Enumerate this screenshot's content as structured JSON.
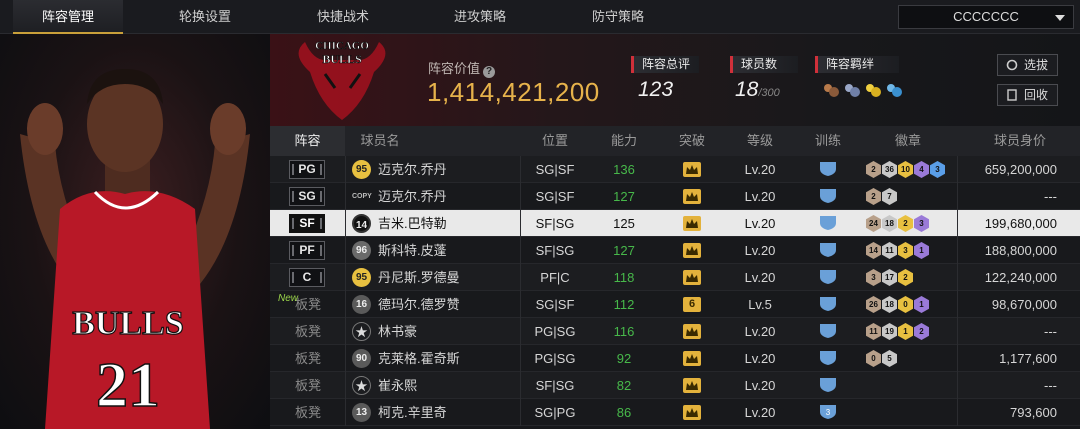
{
  "nav": {
    "tabs": [
      "阵容管理",
      "轮换设置",
      "快捷战术",
      "进攻策略",
      "防守策略"
    ],
    "active_index": 0,
    "team_select": "CCCCCCC"
  },
  "summary": {
    "value_label": "阵容价值",
    "value": "1,414,421,200",
    "overall_label": "阵容总评",
    "overall": "123",
    "count_label": "球员数",
    "count": "18",
    "count_max": "/300",
    "chem_label": "阵容羁绊",
    "select_button": "选拔",
    "recycle_button": "回收",
    "logo_text": "CHICAGO BULLS"
  },
  "table": {
    "headers": [
      "阵容",
      "球员名",
      "位置",
      "能力",
      "突破",
      "等级",
      "训练",
      "徽章",
      "球员身价"
    ],
    "rows": [
      {
        "slot": "PG",
        "rating": "95",
        "name": "迈克尔.乔丹",
        "pos": "SG|SF",
        "ability": "136",
        "break": "",
        "level": "Lv.20",
        "train": "",
        "badges": [
          "2",
          "36",
          "10",
          "4",
          "3"
        ],
        "salary": "659,200,000"
      },
      {
        "slot": "SG",
        "rating": "COPY",
        "name": "迈克尔.乔丹",
        "pos": "SG|SF",
        "ability": "127",
        "break": "",
        "level": "Lv.20",
        "train": "",
        "badges": [
          "2",
          "7"
        ],
        "salary": "---"
      },
      {
        "slot": "SF",
        "rating": "14",
        "name": "吉米.巴特勒",
        "pos": "SF|SG",
        "ability": "125",
        "break": "",
        "level": "Lv.20",
        "train": "",
        "badges": [
          "24",
          "18",
          "2",
          "3"
        ],
        "salary": "199,680,000"
      },
      {
        "slot": "PF",
        "rating": "96",
        "name": "斯科特.皮蓬",
        "pos": "SF|SG",
        "ability": "127",
        "break": "",
        "level": "Lv.20",
        "train": "",
        "badges": [
          "14",
          "11",
          "3",
          "1"
        ],
        "salary": "188,800,000"
      },
      {
        "slot": "C",
        "rating": "95",
        "name": "丹尼斯.罗德曼",
        "pos": "PF|C",
        "ability": "118",
        "break": "",
        "level": "Lv.20",
        "train": "",
        "badges": [
          "3",
          "17",
          "2"
        ],
        "salary": "122,240,000"
      },
      {
        "slot": "板凳",
        "new": "New",
        "rating": "16",
        "name": "德玛尔.德罗赞",
        "pos": "SG|SF",
        "ability": "112",
        "break": "6",
        "level": "Lv.5",
        "train": "",
        "badges": [
          "26",
          "18",
          "0",
          "1"
        ],
        "salary": "98,670,000"
      },
      {
        "slot": "板凳",
        "rating": "★",
        "name": "林书豪",
        "pos": "PG|SG",
        "ability": "116",
        "break": "",
        "level": "Lv.20",
        "train": "",
        "badges": [
          "11",
          "19",
          "1",
          "2"
        ],
        "salary": "---"
      },
      {
        "slot": "板凳",
        "rating": "90",
        "name": "克莱格.霍奇斯",
        "pos": "PG|SG",
        "ability": "92",
        "break": "",
        "level": "Lv.20",
        "train": "",
        "badges": [
          "0",
          "5"
        ],
        "salary": "1,177,600"
      },
      {
        "slot": "板凳",
        "rating": "★",
        "name": "崔永熙",
        "pos": "SF|SG",
        "ability": "82",
        "break": "",
        "level": "Lv.20",
        "train": "",
        "badges": [],
        "salary": "---"
      },
      {
        "slot": "板凳",
        "rating": "13",
        "name": "柯克.辛里奇",
        "pos": "SG|PG",
        "ability": "86",
        "break": "",
        "level": "Lv.20",
        "train": "3",
        "badges": [],
        "salary": "793,600"
      }
    ]
  },
  "colors": {
    "accent_gold": "#e7b34b",
    "ability_green": "#47b84a",
    "team_red": "#c8102e"
  }
}
